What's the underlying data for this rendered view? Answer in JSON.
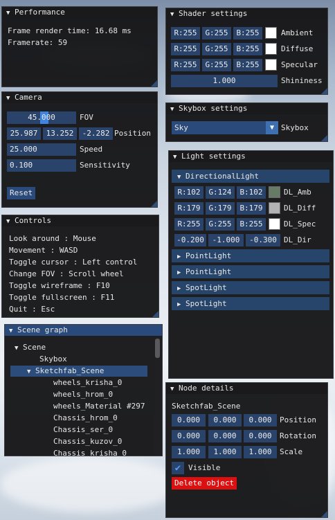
{
  "performance": {
    "title": "Performance",
    "frame_render": "Frame render time: 16.68 ms",
    "framerate": "Framerate: 59"
  },
  "camera": {
    "title": "Camera",
    "fov_value": "45.000",
    "fov_label": "FOV",
    "pos_x": "25.987",
    "pos_y": "13.252",
    "pos_z": "-2.282",
    "pos_label": "Position",
    "speed_value": "25.000",
    "speed_label": "Speed",
    "sens_value": "0.100",
    "sens_label": "Sensitivity",
    "reset_label": "Reset"
  },
  "controls": {
    "title": "Controls",
    "lines": [
      "Look around : Mouse",
      "Movement : WASD",
      "Toggle cursor : Left control",
      "Change FOV : Scroll wheel",
      "Toggle wireframe : F10",
      "Toggle fullscreen : F11",
      "Quit : Esc"
    ]
  },
  "scene_graph": {
    "title": "Scene graph",
    "root": "Scene",
    "skybox": "Skybox",
    "selected": "Sketchfab_Scene",
    "children": [
      "wheels_krisha_0",
      "wheels_hrom_0",
      "wheels_Material #297",
      "Chassis_hrom_0",
      "Chassis_ser_0",
      "Chassis_kuzov_0",
      "Chassis_krisha_0"
    ]
  },
  "shader": {
    "title": "Shader settings",
    "rows": [
      {
        "r": "R:255",
        "g": "G:255",
        "b": "B:255",
        "label": "Ambient",
        "color": "#ffffff"
      },
      {
        "r": "R:255",
        "g": "G:255",
        "b": "B:255",
        "label": "Diffuse",
        "color": "#ffffff"
      },
      {
        "r": "R:255",
        "g": "G:255",
        "b": "B:255",
        "label": "Specular",
        "color": "#ffffff"
      }
    ],
    "shininess_value": "1.000",
    "shininess_label": "Shininess"
  },
  "skybox": {
    "title": "Skybox settings",
    "selected": "Sky",
    "label": "Skybox"
  },
  "light": {
    "title": "Light settings",
    "directional_header": "DirectionalLight",
    "rows": [
      {
        "r": "R:102",
        "g": "G:124",
        "b": "B:102",
        "label": "DL_Amb",
        "color": "#667c66"
      },
      {
        "r": "R:179",
        "g": "G:179",
        "b": "B:179",
        "label": "DL_Diff",
        "color": "#b3b3b3"
      },
      {
        "r": "R:255",
        "g": "G:255",
        "b": "B:255",
        "label": "DL_Spec",
        "color": "#ffffff"
      }
    ],
    "dir_x": "-0.200",
    "dir_y": "-1.000",
    "dir_z": "-0.300",
    "dir_label": "DL_Dir",
    "headers": [
      "PointLight",
      "PointLight",
      "SpotLight",
      "SpotLight"
    ]
  },
  "node": {
    "title": "Node details",
    "name": "Sketchfab_Scene",
    "position": [
      "0.000",
      "0.000",
      "0.000"
    ],
    "position_label": "Position",
    "rotation": [
      "0.000",
      "0.000",
      "0.000"
    ],
    "rotation_label": "Rotation",
    "scale": [
      "1.000",
      "1.000",
      "1.000"
    ],
    "scale_label": "Scale",
    "visible_label": "Visible",
    "visible": true,
    "delete_label": "Delete object"
  }
}
